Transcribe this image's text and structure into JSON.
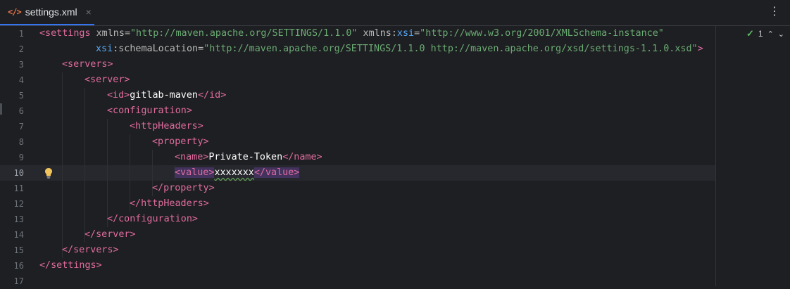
{
  "tab": {
    "icon": "</>",
    "file_name": "settings.xml",
    "close": "×"
  },
  "menu": "⋮",
  "inspection": {
    "count": "1",
    "check": "✓",
    "up": "⌃",
    "down": "⌄"
  },
  "line_numbers": [
    "1",
    "2",
    "3",
    "4",
    "5",
    "6",
    "7",
    "8",
    "9",
    "10",
    "11",
    "12",
    "13",
    "14",
    "15",
    "16",
    "17"
  ],
  "current_line": "10",
  "code": {
    "l1": {
      "open": "<settings",
      "a1": "xmlns",
      "eq": "=",
      "v1": "\"http://maven.apache.org/SETTINGS/1.1.0\"",
      "a2ns": "xmlns",
      "colon": ":",
      "a2": "xsi",
      "v2": "\"http://www.w3.org/2001/XMLSchema-instance\""
    },
    "l2": {
      "ns": "xsi",
      "attr": "schemaLocation",
      "value": "\"http://maven.apache.org/SETTINGS/1.1.0 http://maven.apache.org/xsd/settings-1.1.0.xsd\"",
      "close": ">"
    },
    "l3": "<servers>",
    "l4": "<server>",
    "l5": {
      "open": "<id>",
      "text": "gitlab-maven",
      "close": "</id>"
    },
    "l6": "<configuration>",
    "l7": "<httpHeaders>",
    "l8": "<property>",
    "l9": {
      "open": "<name>",
      "text": "Private-Token",
      "close": "</name>"
    },
    "l10": {
      "open": "<value>",
      "text": "xxxxxxx",
      "close": "</value>"
    },
    "l11": "</property>",
    "l12": "</httpHeaders>",
    "l13": "</configuration>",
    "l14": "</server>",
    "l15": "</servers>",
    "l16": "</settings>"
  }
}
